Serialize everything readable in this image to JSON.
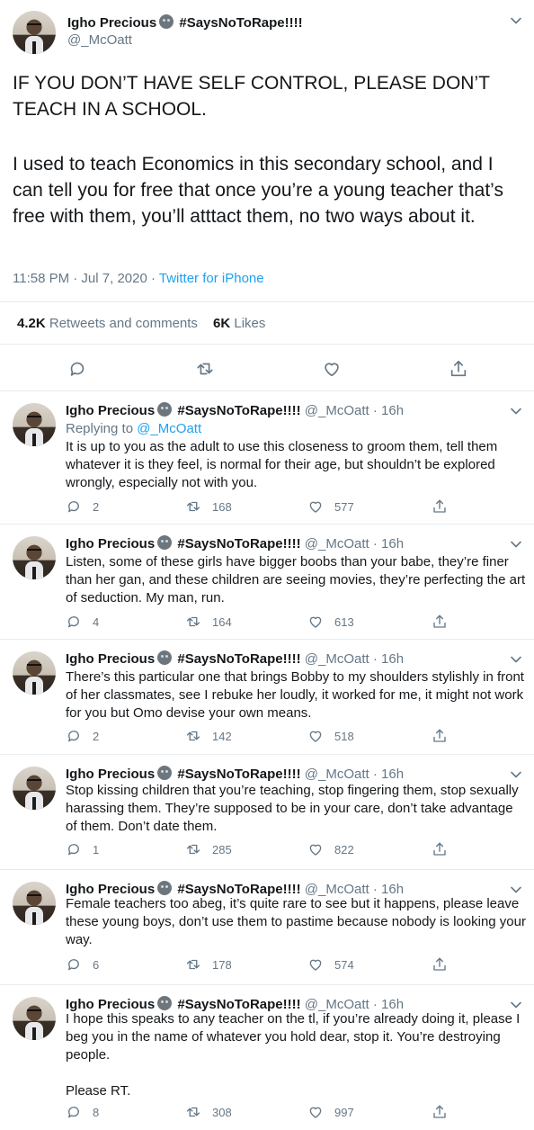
{
  "main": {
    "name": "Igho Precious",
    "tag": "#SaysNoToRape!!!!",
    "handle": "@_McOatt",
    "paragraph1": "IF YOU DON’T HAVE SELF CONTROL, PLEASE DON’T TEACH IN A SCHOOL.",
    "paragraph2": "I used to teach Economics in this secondary school, and I can tell you for free that once you’re a young teacher that’s free with them, you’ll atttact them, no two ways about it.",
    "timestamp": "11:58 PM · Jul 7, 2020 · ",
    "source": "Twitter for iPhone",
    "retweets_count": "4.2K",
    "retweets_label": " Retweets and comments",
    "likes_count": "6K",
    "likes_label": " Likes",
    "icons": [
      "reply-icon",
      "retweet-icon",
      "like-icon",
      "share-icon",
      "chevron-down-icon",
      "emoji-icon"
    ]
  },
  "replies": [
    {
      "name": "Igho Precious",
      "tag": "#SaysNoToRape!!!!",
      "meta": " @_McOatt · 16h",
      "replying_prefix": "Replying to ",
      "replying_handle": "@_McOatt",
      "paragraphs": [
        "It is up to you as the adult to use this closeness to groom them, tell them whatever it is they feel, is normal for their age, but shouldn’t be explored wrongly, especially not with you."
      ],
      "replies": "2",
      "retweets": "168",
      "likes": "577"
    },
    {
      "name": "Igho Precious",
      "tag": "#SaysNoToRape!!!!",
      "meta": " @_McOatt · 16h",
      "paragraphs": [
        "Listen, some of these girls have bigger boobs than your babe, they’re finer than her gan, and these children are seeing movies, they’re perfecting the art of seduction. My man, run."
      ],
      "replies": "4",
      "retweets": "164",
      "likes": "613"
    },
    {
      "name": "Igho Precious",
      "tag": "#SaysNoToRape!!!!",
      "meta": " @_McOatt · 16h",
      "paragraphs": [
        "There’s this particular one that brings Bobby to my shoulders stylishly in front of her classmates, see I rebuke her loudly, it worked for me, it might not work for you but Omo devise your own means."
      ],
      "replies": "2",
      "retweets": "142",
      "likes": "518"
    },
    {
      "name": "Igho Precious",
      "tag": "#SaysNoToRape!!!!",
      "meta": " @_McOatt · 16h",
      "paragraphs": [
        "Stop kissing children that you’re teaching, stop fingering them, stop sexually harassing them. They’re supposed to be in your care, don’t take advantage of them. Don’t date them."
      ],
      "replies": "1",
      "retweets": "285",
      "likes": "822"
    },
    {
      "name": "Igho Precious",
      "tag": "#SaysNoToRape!!!!",
      "meta": " @_McOatt · 16h",
      "paragraphs": [
        "Female teachers too abeg, it’s quite rare to see but it happens, please leave these young boys, don’t use them to pastime because nobody is looking your way."
      ],
      "replies": "6",
      "retweets": "178",
      "likes": "574"
    },
    {
      "name": "Igho Precious",
      "tag": "#SaysNoToRape!!!!",
      "meta": " @_McOatt · 16h",
      "paragraphs": [
        "I hope this speaks to any teacher on the tl, if you’re already doing it, please I beg you in the name of whatever you hold dear, stop it. You’re destroying people.",
        "Please RT."
      ],
      "replies": "8",
      "retweets": "308",
      "likes": "997"
    }
  ],
  "colors": {
    "text": "#14171a",
    "secondary": "#657786",
    "link": "#1da1f2",
    "border": "#e6ecf0"
  }
}
